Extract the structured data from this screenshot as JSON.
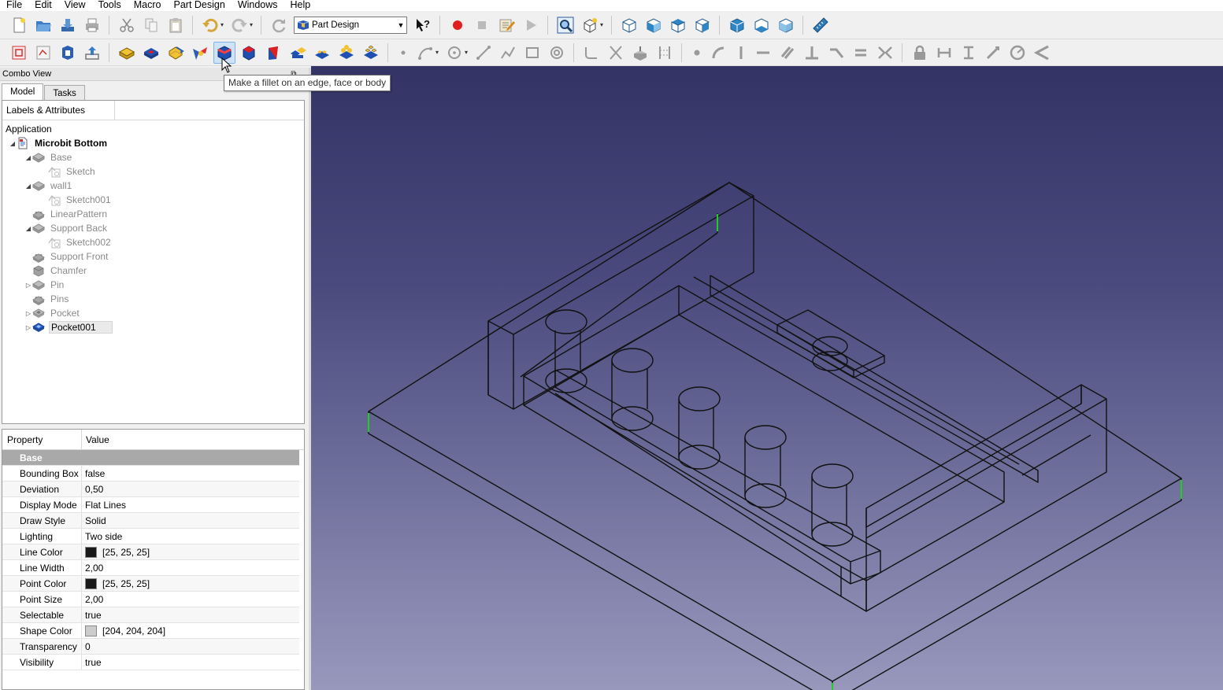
{
  "menubar": {
    "items": [
      "File",
      "Edit",
      "View",
      "Tools",
      "Macro",
      "Part Design",
      "Windows",
      "Help"
    ]
  },
  "toolbar": {
    "workbench_selected": "Part Design"
  },
  "tooltip": {
    "text": "Make a fillet on an edge, face or body"
  },
  "combo_view": {
    "title": "Combo View",
    "tabs": [
      "Model",
      "Tasks"
    ],
    "active_tab": "Model"
  },
  "tree": {
    "header": "Labels & Attributes",
    "section": "Application",
    "items": [
      {
        "label": "Microbit Bottom",
        "depth": 0,
        "expander": "open",
        "icon": "document-icon",
        "root": true
      },
      {
        "label": "Base",
        "depth": 1,
        "expander": "open",
        "icon": "pad-icon"
      },
      {
        "label": "Sketch",
        "depth": 2,
        "expander": "none",
        "icon": "sketch-icon"
      },
      {
        "label": "wall1",
        "depth": 1,
        "expander": "open",
        "icon": "pad-icon"
      },
      {
        "label": "Sketch001",
        "depth": 2,
        "expander": "none",
        "icon": "sketch-icon"
      },
      {
        "label": "LinearPattern",
        "depth": 1,
        "expander": "none",
        "icon": "pattern-icon"
      },
      {
        "label": "Support Back",
        "depth": 1,
        "expander": "open",
        "icon": "pad-icon"
      },
      {
        "label": "Sketch002",
        "depth": 2,
        "expander": "none",
        "icon": "sketch-icon"
      },
      {
        "label": "Support Front",
        "depth": 1,
        "expander": "none",
        "icon": "pattern-icon"
      },
      {
        "label": "Chamfer",
        "depth": 1,
        "expander": "none",
        "icon": "chamfer-icon"
      },
      {
        "label": "Pin",
        "depth": 1,
        "expander": "closed",
        "icon": "pad-icon"
      },
      {
        "label": "Pins",
        "depth": 1,
        "expander": "none",
        "icon": "pattern-icon"
      },
      {
        "label": "Pocket",
        "depth": 1,
        "expander": "closed",
        "icon": "pocket-icon"
      },
      {
        "label": "Pocket001",
        "depth": 1,
        "expander": "closed",
        "icon": "pocket-blue-icon",
        "selected": true
      }
    ]
  },
  "properties": {
    "header_property": "Property",
    "header_value": "Value",
    "group": "Base",
    "rows": [
      {
        "name": "Bounding Box",
        "value": "false"
      },
      {
        "name": "Deviation",
        "value": "0,50"
      },
      {
        "name": "Display Mode",
        "value": "Flat Lines"
      },
      {
        "name": "Draw Style",
        "value": "Solid"
      },
      {
        "name": "Lighting",
        "value": "Two side"
      },
      {
        "name": "Line Color",
        "value": "[25, 25, 25]",
        "swatch": "#191919"
      },
      {
        "name": "Line Width",
        "value": "2,00"
      },
      {
        "name": "Point Color",
        "value": "[25, 25, 25]",
        "swatch": "#191919"
      },
      {
        "name": "Point Size",
        "value": "2,00"
      },
      {
        "name": "Selectable",
        "value": "true"
      },
      {
        "name": "Shape Color",
        "value": "[204, 204, 204]",
        "swatch": "#cccccc"
      },
      {
        "name": "Transparency",
        "value": "0"
      },
      {
        "name": "Visibility",
        "value": "true"
      }
    ]
  },
  "colors": {
    "viewport_top": "#333366",
    "viewport_bottom": "#9898bd",
    "wireframe": "#111111",
    "highlight_edge": "#22cc22"
  }
}
